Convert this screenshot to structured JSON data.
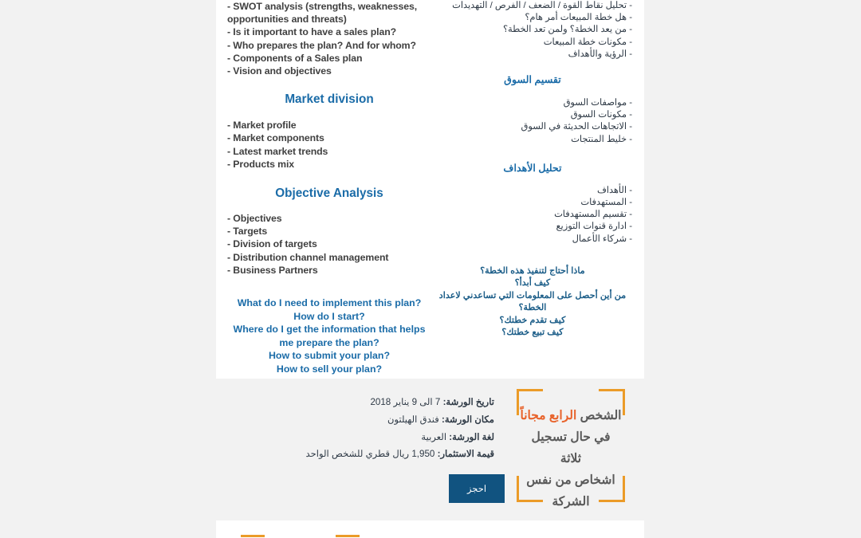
{
  "agenda": {
    "english": {
      "intro_bullets": [
        "- SWOT analysis (strengths, weaknesses, opportunities and threats)",
        "- Is it important to have a sales plan?",
        "- Who prepares the plan? And for whom?",
        "- Components of a Sales plan",
        "- Vision and objectives"
      ],
      "section_market_title": "Market division",
      "market_bullets": [
        "- Market profile",
        "- Market components",
        "- Latest market trends",
        "- Products mix"
      ],
      "section_objective_title": "Objective Analysis",
      "objective_bullets": [
        "- Objectives",
        "- Targets",
        "- Division of targets",
        "- Distribution channel management",
        "- Business Partners"
      ],
      "questions": [
        "What do I need to implement this plan?",
        "How do I start?",
        "Where do I get the information that helps me prepare the plan?",
        "How to submit your plan?",
        "How to sell your plan?"
      ]
    },
    "arabic": {
      "intro_bullets": [
        "- تحليل نقاط القوة / الضعف / الفرص / التهديدات",
        "- هل خطة المبيعات أمر هام؟",
        "- من يعد الخطة؟ ولمن تعد الخطة؟",
        "- مكونات خطة المبيعات",
        "- الرؤية والأهداف"
      ],
      "section_market_title": "تقسيم السوق",
      "market_bullets": [
        "- مواصفات السوق",
        "- مكونات السوق",
        "- الاتجاهات الحديثة في السوق",
        "- خليط المنتجات"
      ],
      "section_objective_title": "تحليل الأهداف",
      "objective_bullets": [
        "- الأهداف",
        "- المستهدفات",
        "- تقسيم المستهدفات",
        "- ادارة قنوات التوزيع",
        "- شركاء الأعمال"
      ],
      "questions": [
        "ماذا أحتاج لتنفيذ هذه الخطة؟",
        "كيف أبدأ؟",
        "من أين أحصل على المعلومات التي تساعدني لاعداد الخطة؟",
        "كيف تقدم خطتك؟",
        "كيف تبيع خطتك؟"
      ]
    }
  },
  "workshop_details": {
    "date_label": "تاريخ الورشة:",
    "date_value": "7 الى 9 يناير 2018",
    "venue_label": "مكان الورشة:",
    "venue_value": "فندق الهيلتون",
    "language_label": "لغة الورشة:",
    "language_value": "العربية",
    "price_label": "قيمة الاستثمار:",
    "price_value": "1,950 ريال قطري للشخص الواحد",
    "book_button_label": "احجز"
  },
  "promo": {
    "line1_prefix": "الشخص ",
    "line1_highlight": "الرابع مجاناً",
    "line2": "في حال تسجيل ثلاثة",
    "line3": "اشخاص من نفس",
    "line4": "الشركة",
    "highlight_color": "#e8622a",
    "border_color": "#eb9b28"
  },
  "theme": {
    "page_background": "#f2f2f2",
    "card_background": "#ffffff",
    "heading_blue": "#1b6ca8",
    "body_text": "#404040",
    "button_background": "#115380",
    "button_text": "#ffffff"
  }
}
